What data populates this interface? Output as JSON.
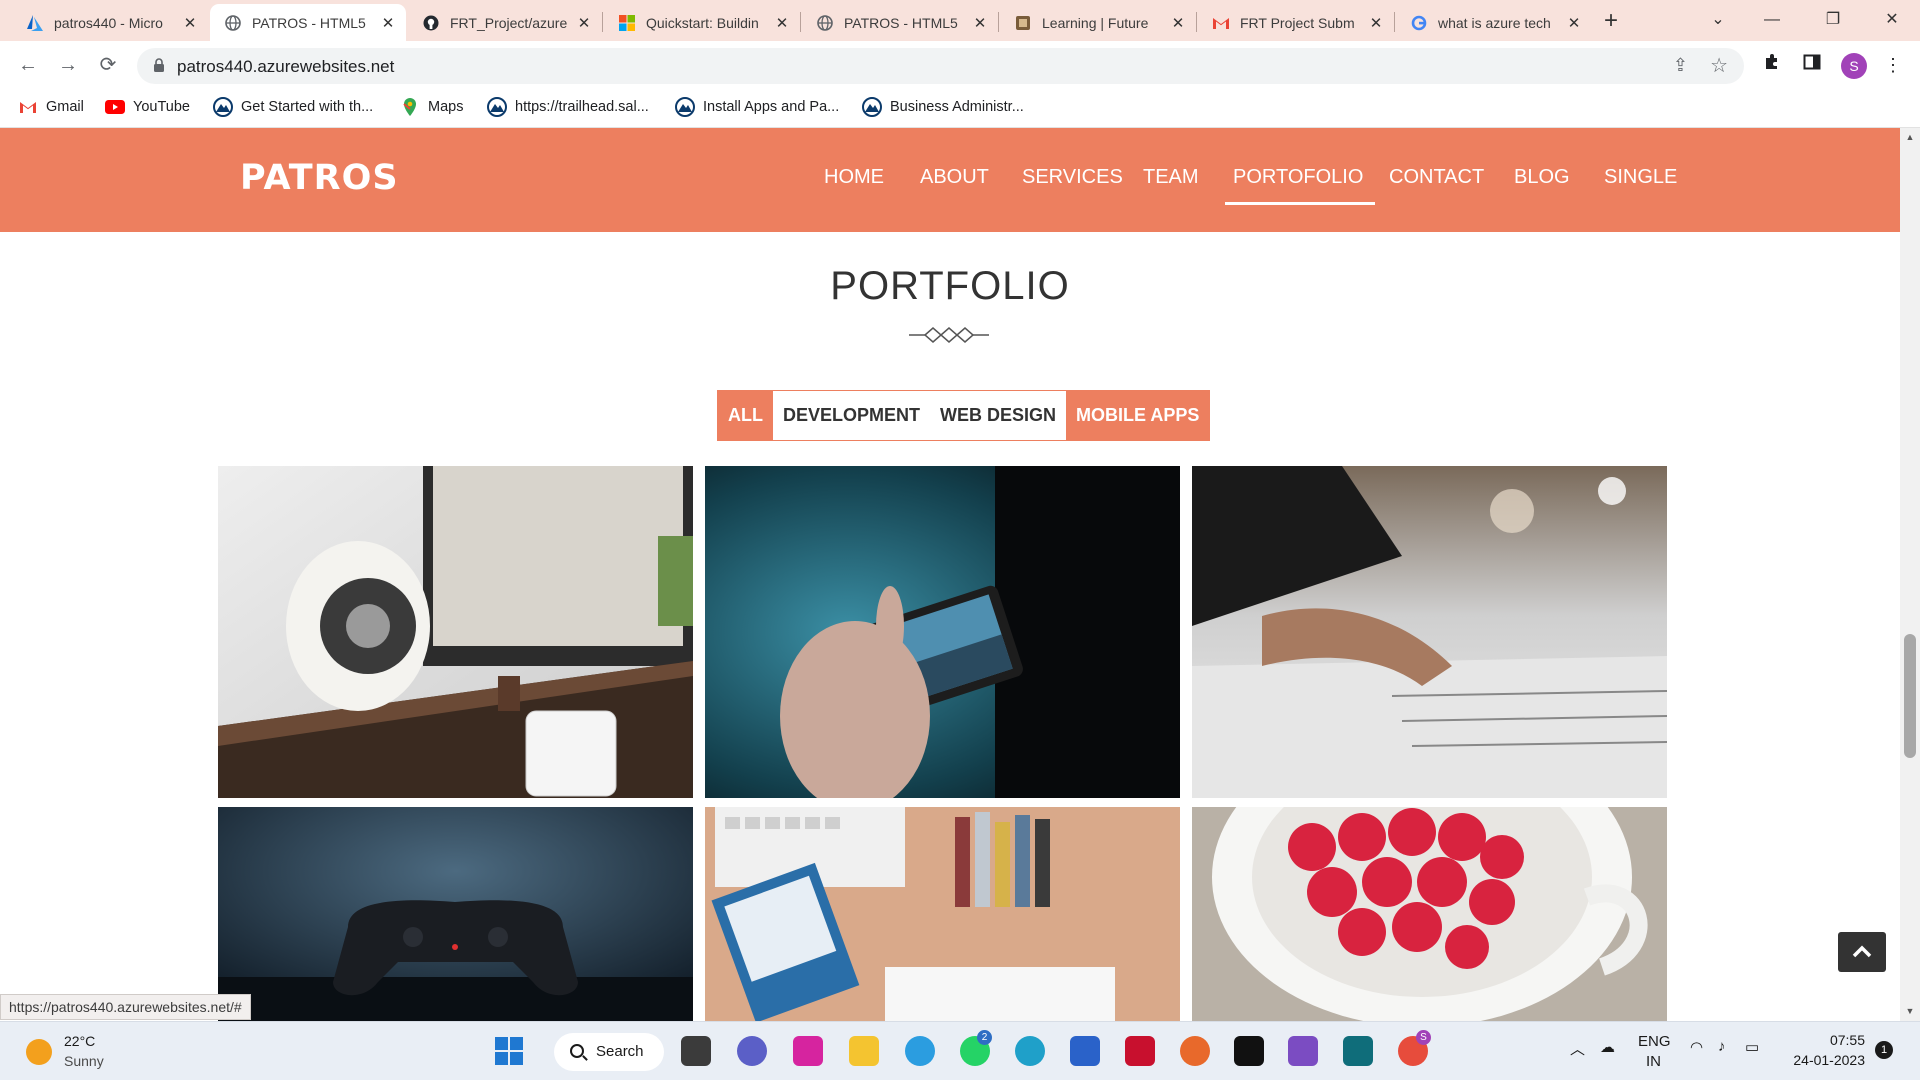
{
  "browser": {
    "tabs": [
      {
        "title": "patros440 - Micro",
        "icon": "azure-icon"
      },
      {
        "title": "PATROS - HTML5",
        "icon": "globe-icon",
        "active": true
      },
      {
        "title": "FRT_Project/azure",
        "icon": "github-icon"
      },
      {
        "title": "Quickstart: Buildin",
        "icon": "microsoft-icon"
      },
      {
        "title": "PATROS - HTML5",
        "icon": "globe-icon"
      },
      {
        "title": "Learning | Future",
        "icon": "futureskills-icon"
      },
      {
        "title": "FRT Project Subm",
        "icon": "gmail-icon"
      },
      {
        "title": "what is azure tech",
        "icon": "google-icon"
      }
    ],
    "url": "patros440.azurewebsites.net",
    "profile_initial": "S",
    "bookmarks": [
      {
        "label": "Gmail",
        "icon": "gmail-icon"
      },
      {
        "label": "YouTube",
        "icon": "youtube-icon"
      },
      {
        "label": "Get Started with th...",
        "icon": "trailhead-icon"
      },
      {
        "label": "Maps",
        "icon": "maps-icon"
      },
      {
        "label": "https://trailhead.sal...",
        "icon": "trailhead-icon"
      },
      {
        "label": "Install Apps and Pa...",
        "icon": "trailhead-icon"
      },
      {
        "label": "Business Administr...",
        "icon": "trailhead-icon"
      }
    ],
    "status_url": "https://patros440.azurewebsites.net/#"
  },
  "site": {
    "logo": "PATROS",
    "nav": [
      "HOME",
      "ABOUT",
      "SERVICES",
      "TEAM",
      "PORTOFOLIO",
      "CONTACT",
      "BLOG",
      "SINGLE"
    ],
    "active_nav": "PORTOFOLIO",
    "accent_color": "#ed7f5f"
  },
  "portfolio": {
    "title": "PORTFOLIO",
    "filters": [
      {
        "label": "ALL",
        "active": true
      },
      {
        "label": "DEVELOPMENT",
        "active": false
      },
      {
        "label": "WEB DESIGN",
        "active": false
      },
      {
        "label": "MOBILE APPS",
        "active": true
      }
    ],
    "items": [
      {
        "name": "speaker-desk-image"
      },
      {
        "name": "phone-photo-image"
      },
      {
        "name": "mixing-console-image"
      },
      {
        "name": "game-controller-image"
      },
      {
        "name": "workspace-ipad-image"
      },
      {
        "name": "raspberries-cup-image"
      }
    ]
  },
  "taskbar": {
    "weather_temp": "22°C",
    "weather_cond": "Sunny",
    "search_label": "Search",
    "language": "ENG",
    "region": "IN",
    "time": "07:55",
    "date": "24-01-2023",
    "notification_count": "1",
    "whatsapp_badge": "2",
    "chrome_badge": "S"
  }
}
